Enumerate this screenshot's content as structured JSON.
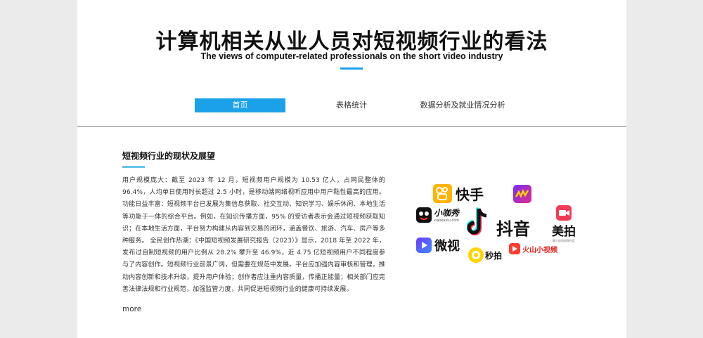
{
  "header": {
    "title_cn": "计算机相关从业人员对短视频行业的看法",
    "title_en": "The views of computer-related professionals on the short video industry"
  },
  "nav": {
    "items": [
      {
        "label": "首页",
        "active": true
      },
      {
        "label": "表格统计",
        "active": false
      },
      {
        "label": "数据分析及就业情况分析",
        "active": false
      }
    ]
  },
  "section": {
    "title": "短视频行业的现状及展望",
    "body": "用户规模庞大：截至 2023 年 12 月，短视频用户规模为 10.53 亿人，占网民整体的 96.4%，人均单日使用时长超过 2.5 小时，是移动端网络视听应用中用户黏性最高的应用。功能日益丰富：短视频平台已发展为集信息获取、社交互动、知识学习、娱乐休闲、本地生活等功能于一体的综合平台。例如，在知识传播方面，95% 的受访者表示会通过短视频获取知识；在本地生活方面，平台努力构建从内容到交易的闭环，涵盖餐饮、旅游、汽车、房产等多种服务。 全民创作热潮：《中国短视频发展研究报告（2023）》显示，2018 年至 2022 年，发布过自制短视频的用户比例从 28.2% 攀升至 46.9%，近 4.75 亿短视频用户不同程度参与了内容创作。短视频行业前景广阔，但需要在规范中发展。平台应加强内容审核和管理，推动内容创新和技术升级，提升用户体验；创作者应注重内容质量，传播正能量；相关部门应完善法律法规和行业规范，加强监管力度，共同促进短视频行业的健康可持续发展。",
    "more_label": "more"
  },
  "logos": {
    "kuaishou": "快手",
    "xiaokaxiu": "小咖秀",
    "xiaokaxiu_url": "xiaokaxiu.com",
    "douyin": "抖音",
    "meipai": "美拍",
    "meipai_sub": "最大的短视频社区",
    "weishi": "微视",
    "miaopai": "秒拍",
    "huoshan": "火山小视频"
  },
  "colors": {
    "accent": "#1aa1e8",
    "background": "#ebebeb",
    "page": "#ffffff"
  }
}
